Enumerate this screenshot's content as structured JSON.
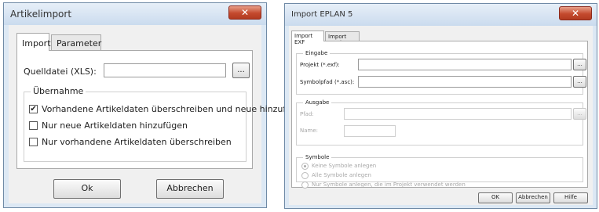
{
  "left_dialog": {
    "title": "Artikelimport",
    "close_glyph": "✕",
    "tabs": [
      "Import",
      "Parameter"
    ],
    "source_file_label": "Quelldatei (XLS):",
    "source_file_value": "",
    "browse_label": "...",
    "group_title": "Übernahme",
    "options": [
      {
        "label": "Vorhandene Artikeldaten überschreiben und neue hinzufügen",
        "checked": true
      },
      {
        "label": "Nur neue Artikeldaten hinzufügen",
        "checked": false
      },
      {
        "label": "Nur vorhandene Artikeldaten überschreiben",
        "checked": false
      }
    ],
    "ok_label": "Ok",
    "cancel_label": "Abbrechen"
  },
  "right_dialog": {
    "title": "Import EPLAN 5",
    "close_glyph": "✕",
    "tabs": [
      "Import EXF",
      "Import Ecad"
    ],
    "input_group": {
      "title": "Eingabe",
      "project_label": "Projekt (*.exf):",
      "project_value": "",
      "symbolpath_label": "Symbolpfad (*.asc):",
      "symbolpath_value": "",
      "browse_label": "..."
    },
    "output_group": {
      "title": "Ausgabe",
      "path_label": "Pfad:",
      "name_label": "Name:",
      "browse_label": "..."
    },
    "symbols_group": {
      "title": "Symbole",
      "options": [
        {
          "label": "Keine Symbole anlegen",
          "selected": true
        },
        {
          "label": "Alle Symbole anlegen",
          "selected": false
        },
        {
          "label": "Nur Symbole anlegen, die im Projekt verwendet werden",
          "selected": false
        }
      ]
    },
    "ok_label": "OK",
    "cancel_label": "Abbrechen",
    "help_label": "Hilfe"
  }
}
